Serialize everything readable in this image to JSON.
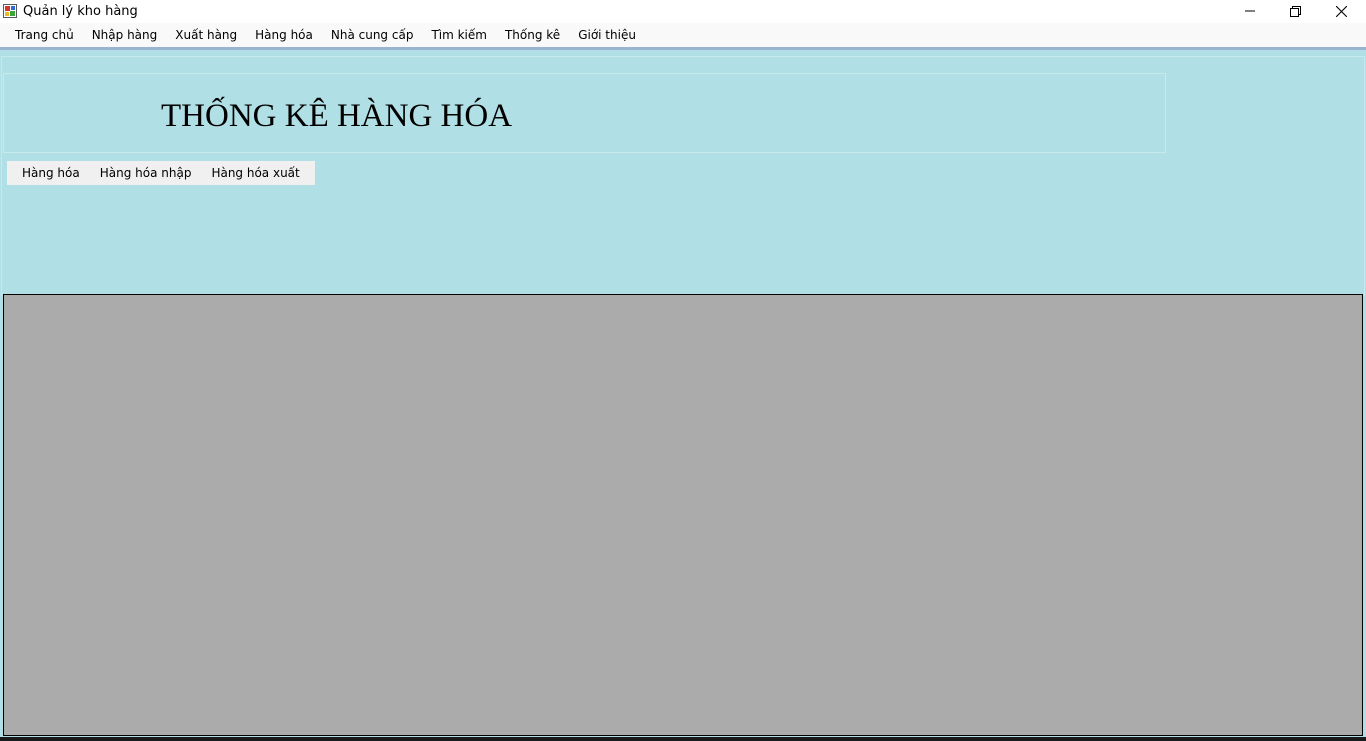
{
  "window": {
    "title": "Quản lý kho hàng",
    "icon": "app-window-icon"
  },
  "menu": {
    "items": [
      {
        "label": "Trang chủ"
      },
      {
        "label": "Nhập hàng"
      },
      {
        "label": "Xuất hàng"
      },
      {
        "label": "Hàng hóa"
      },
      {
        "label": "Nhà cung cấp"
      },
      {
        "label": "Tìm kiếm"
      },
      {
        "label": "Thống kê"
      },
      {
        "label": "Giới thiệu"
      }
    ]
  },
  "main": {
    "heading": "THỐNG KÊ HÀNG HÓA",
    "tabs": [
      {
        "label": "Hàng hóa"
      },
      {
        "label": "Hàng hóa nhập"
      },
      {
        "label": "Hàng hóa xuất"
      }
    ]
  },
  "colors": {
    "background": "#b0dfe5",
    "grid": "#ababab",
    "menu_accent": "#99b4d1"
  }
}
